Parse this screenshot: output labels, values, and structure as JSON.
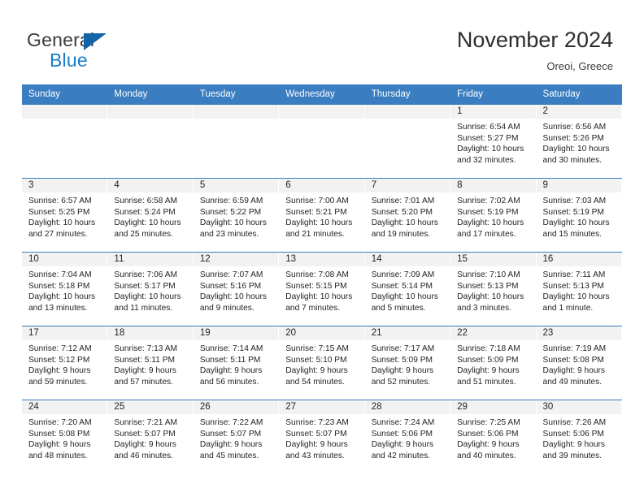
{
  "brand": {
    "name_part1": "General",
    "name_part2": "Blue",
    "triangle_color": "#1464aa",
    "blue_text_color": "#1a7dc4"
  },
  "header": {
    "title": "November 2024",
    "location": "Oreoi, Greece"
  },
  "theme": {
    "header_row_bg": "#3a7dc0",
    "daynum_band_bg": "#f2f2f2",
    "text_color": "#231f20"
  },
  "calendar": {
    "weekday_headers": [
      "Sunday",
      "Monday",
      "Tuesday",
      "Wednesday",
      "Thursday",
      "Friday",
      "Saturday"
    ],
    "labels": {
      "sunrise": "Sunrise:",
      "sunset": "Sunset:",
      "daylight": "Daylight:"
    },
    "weeks": [
      [
        {
          "day": ""
        },
        {
          "day": ""
        },
        {
          "day": ""
        },
        {
          "day": ""
        },
        {
          "day": ""
        },
        {
          "day": "1",
          "sunrise": "Sunrise: 6:54 AM",
          "sunset": "Sunset: 5:27 PM",
          "daylight": "Daylight: 10 hours and 32 minutes."
        },
        {
          "day": "2",
          "sunrise": "Sunrise: 6:56 AM",
          "sunset": "Sunset: 5:26 PM",
          "daylight": "Daylight: 10 hours and 30 minutes."
        }
      ],
      [
        {
          "day": "3",
          "sunrise": "Sunrise: 6:57 AM",
          "sunset": "Sunset: 5:25 PM",
          "daylight": "Daylight: 10 hours and 27 minutes."
        },
        {
          "day": "4",
          "sunrise": "Sunrise: 6:58 AM",
          "sunset": "Sunset: 5:24 PM",
          "daylight": "Daylight: 10 hours and 25 minutes."
        },
        {
          "day": "5",
          "sunrise": "Sunrise: 6:59 AM",
          "sunset": "Sunset: 5:22 PM",
          "daylight": "Daylight: 10 hours and 23 minutes."
        },
        {
          "day": "6",
          "sunrise": "Sunrise: 7:00 AM",
          "sunset": "Sunset: 5:21 PM",
          "daylight": "Daylight: 10 hours and 21 minutes."
        },
        {
          "day": "7",
          "sunrise": "Sunrise: 7:01 AM",
          "sunset": "Sunset: 5:20 PM",
          "daylight": "Daylight: 10 hours and 19 minutes."
        },
        {
          "day": "8",
          "sunrise": "Sunrise: 7:02 AM",
          "sunset": "Sunset: 5:19 PM",
          "daylight": "Daylight: 10 hours and 17 minutes."
        },
        {
          "day": "9",
          "sunrise": "Sunrise: 7:03 AM",
          "sunset": "Sunset: 5:19 PM",
          "daylight": "Daylight: 10 hours and 15 minutes."
        }
      ],
      [
        {
          "day": "10",
          "sunrise": "Sunrise: 7:04 AM",
          "sunset": "Sunset: 5:18 PM",
          "daylight": "Daylight: 10 hours and 13 minutes."
        },
        {
          "day": "11",
          "sunrise": "Sunrise: 7:06 AM",
          "sunset": "Sunset: 5:17 PM",
          "daylight": "Daylight: 10 hours and 11 minutes."
        },
        {
          "day": "12",
          "sunrise": "Sunrise: 7:07 AM",
          "sunset": "Sunset: 5:16 PM",
          "daylight": "Daylight: 10 hours and 9 minutes."
        },
        {
          "day": "13",
          "sunrise": "Sunrise: 7:08 AM",
          "sunset": "Sunset: 5:15 PM",
          "daylight": "Daylight: 10 hours and 7 minutes."
        },
        {
          "day": "14",
          "sunrise": "Sunrise: 7:09 AM",
          "sunset": "Sunset: 5:14 PM",
          "daylight": "Daylight: 10 hours and 5 minutes."
        },
        {
          "day": "15",
          "sunrise": "Sunrise: 7:10 AM",
          "sunset": "Sunset: 5:13 PM",
          "daylight": "Daylight: 10 hours and 3 minutes."
        },
        {
          "day": "16",
          "sunrise": "Sunrise: 7:11 AM",
          "sunset": "Sunset: 5:13 PM",
          "daylight": "Daylight: 10 hours and 1 minute."
        }
      ],
      [
        {
          "day": "17",
          "sunrise": "Sunrise: 7:12 AM",
          "sunset": "Sunset: 5:12 PM",
          "daylight": "Daylight: 9 hours and 59 minutes."
        },
        {
          "day": "18",
          "sunrise": "Sunrise: 7:13 AM",
          "sunset": "Sunset: 5:11 PM",
          "daylight": "Daylight: 9 hours and 57 minutes."
        },
        {
          "day": "19",
          "sunrise": "Sunrise: 7:14 AM",
          "sunset": "Sunset: 5:11 PM",
          "daylight": "Daylight: 9 hours and 56 minutes."
        },
        {
          "day": "20",
          "sunrise": "Sunrise: 7:15 AM",
          "sunset": "Sunset: 5:10 PM",
          "daylight": "Daylight: 9 hours and 54 minutes."
        },
        {
          "day": "21",
          "sunrise": "Sunrise: 7:17 AM",
          "sunset": "Sunset: 5:09 PM",
          "daylight": "Daylight: 9 hours and 52 minutes."
        },
        {
          "day": "22",
          "sunrise": "Sunrise: 7:18 AM",
          "sunset": "Sunset: 5:09 PM",
          "daylight": "Daylight: 9 hours and 51 minutes."
        },
        {
          "day": "23",
          "sunrise": "Sunrise: 7:19 AM",
          "sunset": "Sunset: 5:08 PM",
          "daylight": "Daylight: 9 hours and 49 minutes."
        }
      ],
      [
        {
          "day": "24",
          "sunrise": "Sunrise: 7:20 AM",
          "sunset": "Sunset: 5:08 PM",
          "daylight": "Daylight: 9 hours and 48 minutes."
        },
        {
          "day": "25",
          "sunrise": "Sunrise: 7:21 AM",
          "sunset": "Sunset: 5:07 PM",
          "daylight": "Daylight: 9 hours and 46 minutes."
        },
        {
          "day": "26",
          "sunrise": "Sunrise: 7:22 AM",
          "sunset": "Sunset: 5:07 PM",
          "daylight": "Daylight: 9 hours and 45 minutes."
        },
        {
          "day": "27",
          "sunrise": "Sunrise: 7:23 AM",
          "sunset": "Sunset: 5:07 PM",
          "daylight": "Daylight: 9 hours and 43 minutes."
        },
        {
          "day": "28",
          "sunrise": "Sunrise: 7:24 AM",
          "sunset": "Sunset: 5:06 PM",
          "daylight": "Daylight: 9 hours and 42 minutes."
        },
        {
          "day": "29",
          "sunrise": "Sunrise: 7:25 AM",
          "sunset": "Sunset: 5:06 PM",
          "daylight": "Daylight: 9 hours and 40 minutes."
        },
        {
          "day": "30",
          "sunrise": "Sunrise: 7:26 AM",
          "sunset": "Sunset: 5:06 PM",
          "daylight": "Daylight: 9 hours and 39 minutes."
        }
      ]
    ]
  }
}
